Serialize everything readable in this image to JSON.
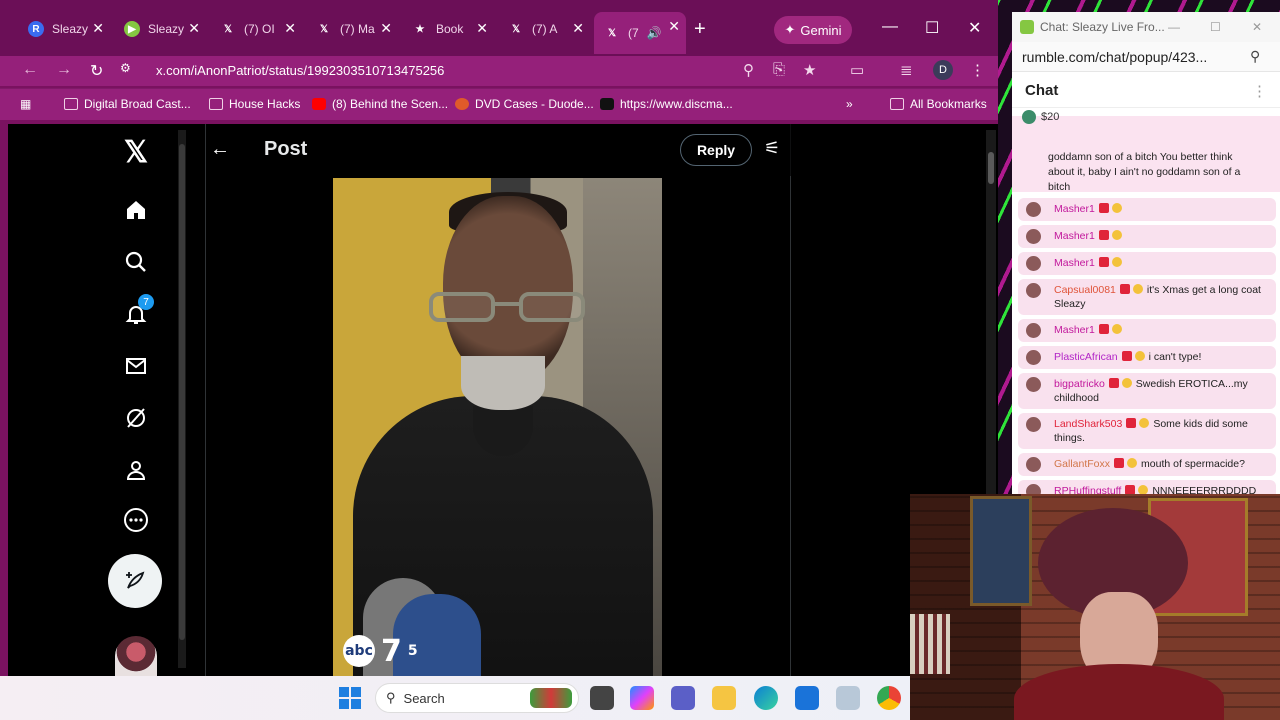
{
  "browser": {
    "tabs": [
      {
        "title": "Sleazy",
        "icon": "rumble-r-icon",
        "color": "#3a6cf0"
      },
      {
        "title": "Sleazy",
        "icon": "rumble-play-icon",
        "color": "#85c742"
      },
      {
        "title": "(7) OI",
        "icon": "x-logo-icon"
      },
      {
        "title": "(7) Ma",
        "icon": "x-logo-icon"
      },
      {
        "title": "Book",
        "icon": "star-icon"
      },
      {
        "title": "(7) A",
        "icon": "x-logo-icon"
      },
      {
        "title": "(7",
        "icon": "x-logo-icon",
        "active": true
      }
    ],
    "gemini_label": "Gemini",
    "url": "x.com/iAnonPatriot/status/1992303510713475256",
    "profile_initial": "D",
    "bookmarks": [
      "Digital Broad Cast...",
      "House Hacks",
      "(8) Behind the Scen...",
      "DVD Cases - Duode...",
      "https://www.discma..."
    ],
    "all_bookmarks_label": "All Bookmarks"
  },
  "x_page": {
    "title": "Post",
    "reply_label": "Reply",
    "notification_count": "7",
    "video": {
      "station_logo": "7",
      "station_channel": "5",
      "station_brand": "abc"
    }
  },
  "chat": {
    "window_title": "Chat: Sleazy Live Fro...",
    "url": "rumble.com/chat/popup/423...",
    "heading": "Chat",
    "rant": {
      "amount": "$20",
      "message": "goddamn son of a bitch You better think about it, baby I ain't no goddamn son of a bitch"
    },
    "messages": [
      {
        "user": "Masher1",
        "text": "",
        "color": "#c2189c"
      },
      {
        "user": "Masher1",
        "text": "",
        "color": "#c2189c"
      },
      {
        "user": "Masher1",
        "text": "",
        "color": "#c2189c"
      },
      {
        "user": "Capsual0081",
        "text": "it's Xmas get a long coat Sleazy",
        "color": "#e0543a"
      },
      {
        "user": "Masher1",
        "text": "",
        "color": "#c2189c"
      },
      {
        "user": "PlasticAfrican",
        "text": "i can't type!",
        "color": "#b225c7"
      },
      {
        "user": "bigpatricko",
        "text": "Swedish EROTICA...my childhood",
        "color": "#c2189c"
      },
      {
        "user": "LandShark503",
        "text": "Some kids did some things.",
        "color": "#e0243a"
      },
      {
        "user": "GallantFoxx",
        "text": "mouth of spermacide?",
        "color": "#d2774a"
      },
      {
        "user": "RPHuffingstuff",
        "text": "NNNEEEERRRDDDD",
        "color": "#c2189c"
      }
    ]
  },
  "taskbar": {
    "search_label": "Search"
  },
  "colors": {
    "browser_accent": "#95207a",
    "x_blue": "#1d9bf0",
    "rant_bg": "#fbe3f0"
  }
}
